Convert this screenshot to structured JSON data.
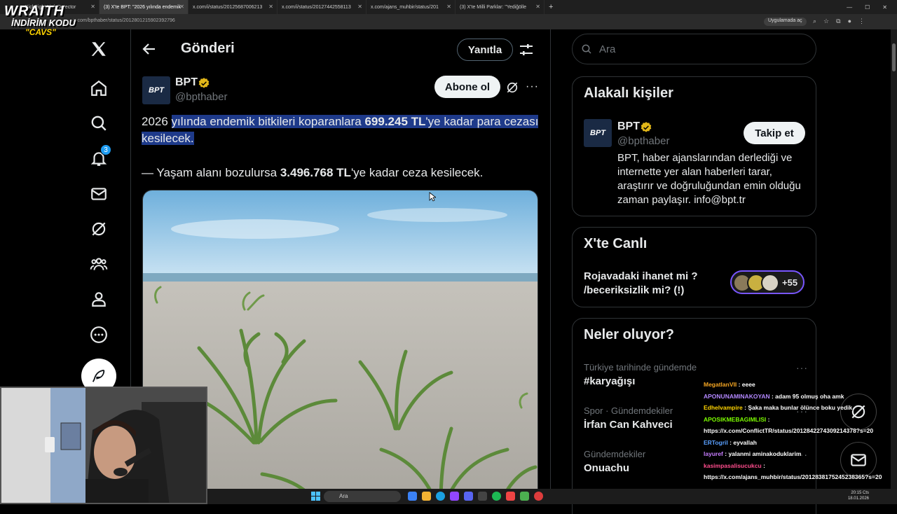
{
  "browser": {
    "tabs": [
      {
        "label": "KickSight Link Detector"
      },
      {
        "label": "(3) X'te BPT: \"2026 yılında endemik"
      },
      {
        "label": "x.com/i/status/20125687006213"
      },
      {
        "label": "x.com/i/status/20127442558113"
      },
      {
        "label": "x.com/ajans_muhbir/status/201"
      },
      {
        "label": "(3) X'te Milli Parklar: \"Yediğölle"
      }
    ],
    "new_tab": "+",
    "url": "x.com/bpthaber/status/2012801215902392796",
    "app_chip": "Uygulamada aç"
  },
  "overlay_logo": {
    "line1": "WRAITH",
    "line2": "İNDİRİM KODU",
    "line3": "\"CAVS\""
  },
  "nav": {
    "notification_count": "3"
  },
  "header": {
    "title": "Gönderi",
    "reply_label": "Yanıtla"
  },
  "post": {
    "name": "BPT",
    "handle": "@bpthaber",
    "subscribe_label": "Abone ol",
    "text_lead": "2026 ",
    "text_hl1": "yılında endemik bitkileri koparanlara ",
    "text_bold": "699.245 TL",
    "text_hl2": "'ye kadar para cezası kesilecek.",
    "line2_pre": "— Yaşam alanı bozulursa ",
    "line2_bold": "3.496.768 TL",
    "line2_post": "'ye kadar ceza kesilecek."
  },
  "search": {
    "placeholder": "Ara"
  },
  "related": {
    "title": "Alakalı kişiler",
    "name": "BPT",
    "handle": "@bpthaber",
    "follow_label": "Takip et",
    "bio": "BPT, haber ajanslarından derlediği ve internette yer alan haberleri tarar, araştırır ve doğruluğundan emin olduğu zaman paylaşır. info@bpt.tr"
  },
  "live": {
    "title": "X'te Canlı",
    "text": "Rojavadaki ihanet mi ? /beceriksizlik mi?  (!)",
    "count": "+55"
  },
  "trends": {
    "title": "Neler oluyor?",
    "items": [
      {
        "context": "Türkiye tarihinde gündemde",
        "name": "#karyağışı"
      },
      {
        "context": "Spor · Gündemdekiler",
        "name": "İrfan Can Kahveci"
      },
      {
        "context": "Gündemdekiler",
        "name": "Onuachu"
      }
    ]
  },
  "chat": [
    {
      "user": "MegatlanVII",
      "msg": ": eeee"
    },
    {
      "user": "APONUNAMINAKOYAN",
      "msg": ": adam 95 olmuş oha amk"
    },
    {
      "user": "Edhelvampire",
      "msg": ": Şaka maka bunlar ölünce boku yedik"
    },
    {
      "user": "APOSIKMEBAGIMLISI",
      "msg": ":"
    },
    {
      "user": "",
      "msg": "https://x.com/ConflictTR/status/2012842274309214378?s=20"
    },
    {
      "user": "ERTogril",
      "msg": ": eyvallah"
    },
    {
      "user": "layuref",
      "msg": ": yalanmi aminakoduklarim"
    },
    {
      "user": "kasimpasalisucukcu",
      "msg": ":"
    },
    {
      "user": "",
      "msg": "https://x.com/ajans_muhbir/status/2012838175245238365?s=20"
    }
  ],
  "taskbar": {
    "search_label": "Ara",
    "time": "20:15 Cts",
    "date": "18.01.2026"
  },
  "colors": {
    "accent": "#1d9bf0",
    "highlight": "#1e3a8a",
    "live": "#7856ff",
    "verified": "#e2b719"
  }
}
